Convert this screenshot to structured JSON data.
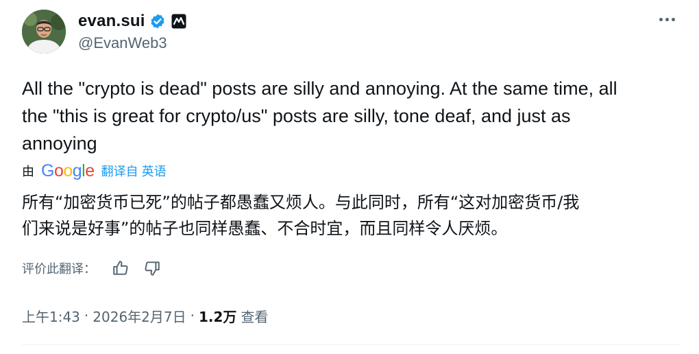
{
  "author": {
    "display_name": "evan.sui",
    "handle": "@EvanWeb3",
    "avatar_icon": "person-portrait",
    "verified_color": "#1d9bf0"
  },
  "tweet": {
    "text": "All the \"crypto is dead\" posts are silly and annoying. At the same time, all\nthe \"this is great for crypto/us\" posts are silly, tone deaf, and just as\nannoying"
  },
  "translation": {
    "prefix": "由",
    "provider": "Google",
    "link_label": "翻译自 英语",
    "text": "所有“加密货币已死”的帖子都愚蠢又烦人。与此同时，所有“这对加密货币/我\n们来说是好事”的帖子也同样愚蠢、不合时宜，而且同样令人厌烦。",
    "rate_label": "评价此翻译："
  },
  "meta": {
    "time": "上午1:43",
    "separator": "·",
    "date": "2026年2月7日",
    "views_count": "1.2万",
    "views_label": "查看"
  },
  "colors": {
    "text": "#0f1419",
    "secondary": "#536471",
    "accent": "#1d9bf0"
  }
}
